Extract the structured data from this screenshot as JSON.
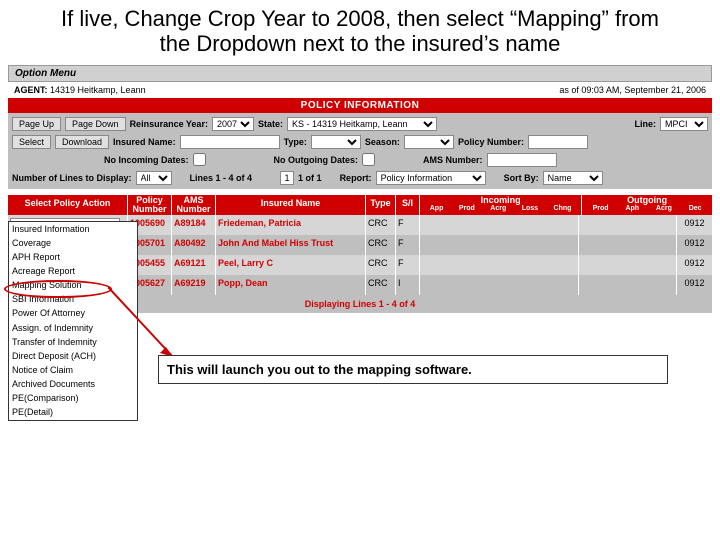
{
  "slide_title": "If live, Change Crop Year to 2008, then select “Mapping” from the Dropdown next to the insured’s name",
  "small_header": "",
  "option_menu": "Option Menu",
  "agent": {
    "label": "AGENT:",
    "value": "14319 Heitkamp, Leann",
    "asof": "as of 09:03 AM, September 21, 2006"
  },
  "policy_info_title": "POLICY INFORMATION",
  "buttons": {
    "pageup": "Page Up",
    "pagedown": "Page Down",
    "select": "Select",
    "download": "Download"
  },
  "filters": {
    "reins_year_lbl": "Reinsurance Year:",
    "reins_year": "2007",
    "state_lbl": "State:",
    "state": "KS - 14319 Heitkamp, Leann",
    "line_lbl": "Line:",
    "line": "MPCI",
    "insured_name_lbl": "Insured Name:",
    "insured_name": "",
    "type_lbl": "Type:",
    "type": "",
    "season_lbl": "Season:",
    "season": "",
    "policyno_lbl": "Policy Number:",
    "policyno": "",
    "no_in_lbl": "No Incoming Dates:",
    "no_out_lbl": "No Outgoing Dates:",
    "amsno_lbl": "AMS Number:",
    "amsno": "",
    "numlines_lbl": "Number of Lines to Display:",
    "numlines": "All",
    "lines_range": "Lines 1 - 4 of 4",
    "page_range": "1 of 1",
    "report_lbl": "Report:",
    "report": "Policy Information",
    "sort_lbl": "Sort By:",
    "sort": "Name"
  },
  "thead": {
    "action": "Select Policy Action",
    "policy": "Policy",
    "ams": "AMS",
    "number": "Number",
    "name": "Insured Name",
    "type": "Type",
    "si": "S/I",
    "incoming": "Incoming",
    "outgoing": "Outgoing",
    "in_sub": [
      "App",
      "Prod",
      "Acrg",
      "Loss",
      "Chng"
    ],
    "out_sub": [
      "Prod",
      "Aph",
      "Acrg",
      "Dec"
    ]
  },
  "rows": [
    {
      "policy": "1005690",
      "ams": "A89184",
      "name": "Friedeman, Patricia",
      "type": "CRC",
      "si": "F",
      "out_acrg": "0912"
    },
    {
      "policy": "1005701",
      "ams": "A80492",
      "name": "John And Mabel Hiss Trust",
      "type": "CRC",
      "si": "F",
      "out_acrg": "0912"
    },
    {
      "policy": "1005455",
      "ams": "A69121",
      "name": "Peel, Larry C",
      "type": "CRC",
      "si": "F",
      "out_acrg": "0912"
    },
    {
      "policy": "1005627",
      "ams": "A69219",
      "name": "Popp, Dean",
      "type": "CRC",
      "si": "I",
      "out_acrg": "0912"
    }
  ],
  "tfoot": "Displaying Lines 1 - 4 of 4",
  "menu_items": [
    "Insured Information",
    "Coverage",
    "APH Report",
    "Acreage Report",
    "Mapping Solution",
    "SBI Information",
    "Power Of Attorney",
    "Assign. of Indemnity",
    "Transfer of Indemnity",
    "Direct Deposit (ACH)",
    "Notice of Claim",
    "Archived Documents",
    "PE(Comparison)",
    "PE(Detail)"
  ],
  "callout": "This will launch you out to the mapping software."
}
